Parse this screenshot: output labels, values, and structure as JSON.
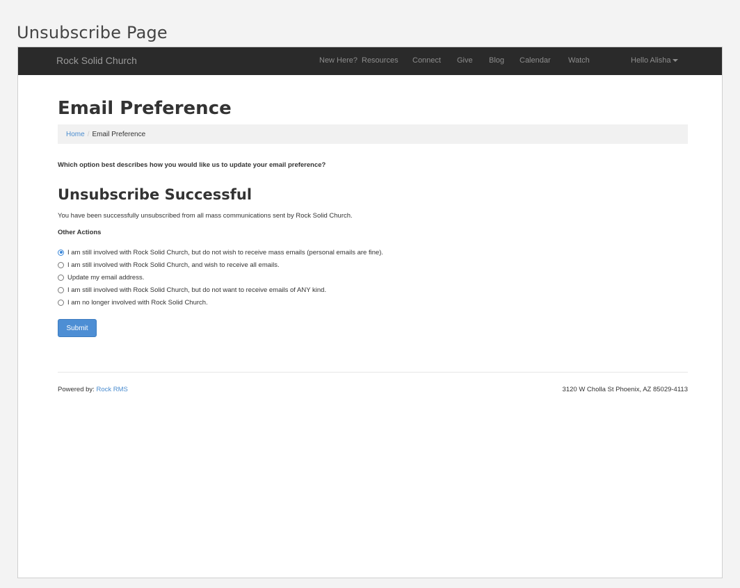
{
  "window": {
    "title": "Unsubscribe Page"
  },
  "navbar": {
    "brand": "Rock Solid Church",
    "links": [
      "New Here?",
      "Resources",
      "Connect",
      "Give",
      "Blog",
      "Calendar",
      "Watch"
    ],
    "user_menu": "Hello Alisha"
  },
  "page": {
    "title": "Email Preference",
    "breadcrumb": {
      "home": "Home",
      "separator": "/",
      "current": "Email Preference"
    },
    "question": "Which option best describes how you would like us to update your email preference?",
    "result_title": "Unsubscribe Successful",
    "result_message": "You have been successfully unsubscribed from all mass communications sent by Rock Solid Church.",
    "other_actions_label": "Other Actions",
    "options": [
      {
        "label": "I am still involved with Rock Solid Church, but do not wish to receive mass emails (personal emails are fine).",
        "checked": true
      },
      {
        "label": "I am still involved with Rock Solid Church, and wish to receive all emails.",
        "checked": false
      },
      {
        "label": "Update my email address.",
        "checked": false
      },
      {
        "label": "I am still involved with Rock Solid Church, but do not want to receive emails of ANY kind.",
        "checked": false
      },
      {
        "label": "I am no longer involved with Rock Solid Church.",
        "checked": false
      }
    ],
    "submit_label": "Submit"
  },
  "footer": {
    "powered_by": "Powered by:",
    "powered_link": "Rock RMS",
    "address": "3120 W Cholla St Phoenix, AZ 85029-4113"
  },
  "colors": {
    "navbar": "#2a2a2a",
    "accent": "#4d8ed4",
    "link": "#4a8ccf"
  },
  "icons": {
    "user_menu_caret": "caret-down-icon",
    "radio": "radio-icon"
  }
}
